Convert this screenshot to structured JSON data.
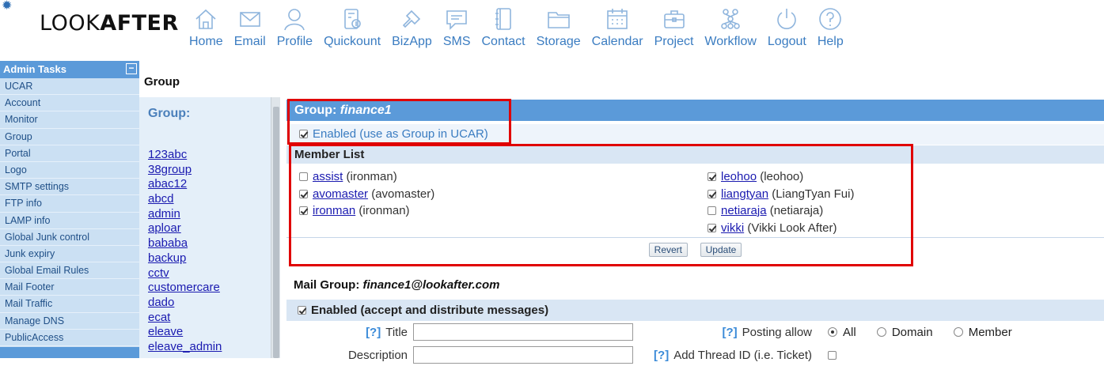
{
  "brand": {
    "logo_light": "LOOK",
    "logo_bold": "AFTER",
    "gear": "✹"
  },
  "nav": [
    {
      "label": "Home",
      "icon": "home-icon"
    },
    {
      "label": "Email",
      "icon": "email-icon"
    },
    {
      "label": "Profile",
      "icon": "profile-icon"
    },
    {
      "label": "Quickount",
      "icon": "quickount-icon"
    },
    {
      "label": "BizApp",
      "icon": "bizapp-icon"
    },
    {
      "label": "SMS",
      "icon": "sms-icon"
    },
    {
      "label": "Contact",
      "icon": "contact-icon"
    },
    {
      "label": "Storage",
      "icon": "storage-icon"
    },
    {
      "label": "Calendar",
      "icon": "calendar-icon"
    },
    {
      "label": "Project",
      "icon": "project-icon"
    },
    {
      "label": "Workflow",
      "icon": "workflow-icon"
    },
    {
      "label": "Logout",
      "icon": "logout-icon"
    },
    {
      "label": "Help",
      "icon": "help-icon"
    }
  ],
  "sidebar": {
    "title": "Admin Tasks",
    "toggle": "−",
    "items": [
      "UCAR",
      "Account",
      "Monitor",
      "Group",
      "Portal",
      "Logo",
      "SMTP settings",
      "FTP info",
      "LAMP info",
      "Global Junk control",
      "Junk expiry",
      "Global Email Rules",
      "Mail Footer",
      "Mail Traffic",
      "Manage DNS",
      "PublicAccess"
    ]
  },
  "page_title": "Group",
  "groups": {
    "title": "Group:",
    "items": [
      "123abc",
      "38group",
      "abac12",
      "abcd",
      "admin",
      "aploar",
      "bababa",
      "backup",
      "cctv",
      "customercare",
      "dado",
      "ecat",
      "eleave",
      "eleave_admin"
    ]
  },
  "group_detail": {
    "head_prefix": "Group: ",
    "name": "finance1",
    "enabled_label": "Enabled (use as Group in UCAR)",
    "enabled": true,
    "member_list_title": "Member List",
    "members_left": [
      {
        "user": "assist",
        "name": "(ironman)",
        "checked": false
      },
      {
        "user": "avomaster",
        "name": "(avomaster)",
        "checked": true
      },
      {
        "user": "ironman",
        "name": "(ironman)",
        "checked": true
      }
    ],
    "members_right": [
      {
        "user": "leohoo",
        "name": "(leohoo)",
        "checked": true
      },
      {
        "user": "liangtyan",
        "name": "(LiangTyan Fui)",
        "checked": true
      },
      {
        "user": "netiaraja",
        "name": "(netiaraja)",
        "checked": false
      },
      {
        "user": "vikki",
        "name": "(Vikki Look After)",
        "checked": true
      }
    ],
    "revert_label": "Revert",
    "update_label": "Update"
  },
  "mail_group": {
    "title_prefix": "Mail Group: ",
    "address": "finance1@lookafter.com",
    "enabled_label": "Enabled (accept and distribute messages)",
    "enabled": true,
    "help_mark": "[?]",
    "title_label": "Title",
    "title_value": "",
    "description_label": "Description",
    "description_value": "",
    "posting_allow_label": "Posting allow",
    "posting_options": [
      "All",
      "Domain",
      "Member"
    ],
    "posting_selected": "All",
    "thread_id_label": "Add Thread ID (i.e. Ticket)",
    "thread_id_checked": false
  },
  "colors": {
    "accent": "#5b9ad9",
    "link": "#1a1ab0",
    "highlight": "#e00000"
  }
}
